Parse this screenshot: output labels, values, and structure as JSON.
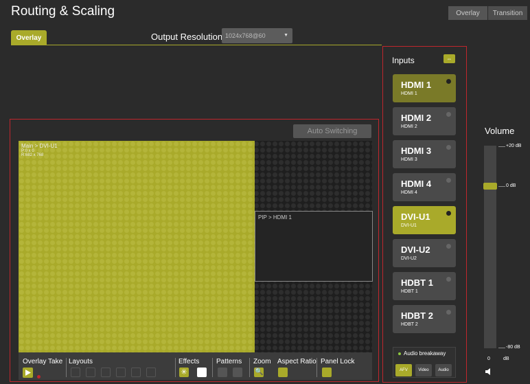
{
  "header": {
    "title": "Routing & Scaling",
    "tabs": [
      "Overlay",
      "Transition"
    ]
  },
  "tabs": {
    "active": "Overlay"
  },
  "output": {
    "label": "Output Resolution",
    "value": "1024x768@60"
  },
  "overlay": {
    "auto_switching": "Auto Switching",
    "main": {
      "title": "Main > DVI-U1",
      "pos": "P:0 x 0",
      "res": "R:682 x 768"
    },
    "pip": {
      "title": "PIP > HDMI 1"
    }
  },
  "toolbar": {
    "overlay_take": "Overlay Take",
    "layouts": "Layouts",
    "effects": "Effects",
    "patterns": "Patterns",
    "zoom": "Zoom",
    "aspect_ratio": "Aspect Ratio",
    "panel_lock": "Panel Lock"
  },
  "inputs": {
    "title": "Inputs",
    "items": [
      {
        "name": "HDMI 1",
        "sub": "HDMI 1"
      },
      {
        "name": "HDMI 2",
        "sub": "HDMI 2"
      },
      {
        "name": "HDMI 3",
        "sub": "HDMI 3"
      },
      {
        "name": "HDMI 4",
        "sub": "HDMI 4"
      },
      {
        "name": "DVI-U1",
        "sub": "DVI-U1"
      },
      {
        "name": "DVI-U2",
        "sub": "DVI-U2"
      },
      {
        "name": "HDBT 1",
        "sub": "HDBT 1"
      },
      {
        "name": "HDBT 2",
        "sub": "HDBT 2"
      }
    ],
    "audio_breakaway": "Audio breakaway",
    "ab_buttons": [
      "AFV",
      "Video",
      "Audio"
    ]
  },
  "volume": {
    "title": "Volume",
    "max": "+20 dB",
    "mid": "0 dB",
    "min": "-80 dB",
    "value": "0",
    "unit": "dB",
    "level_db": 0
  },
  "colors": {
    "accent": "#a9aa2a",
    "highlight_border": "#c0262d"
  }
}
